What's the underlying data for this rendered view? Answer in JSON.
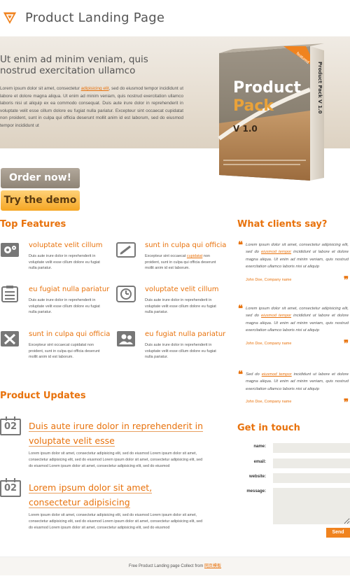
{
  "header": {
    "title": "Product Landing Page"
  },
  "hero": {
    "heading": "Ut enim ad minim veniam, quis nostrud exercitation ullamco",
    "text_before_link": "Lorem ipsum dolor sit amet, consectetur ",
    "link_text": "adipisicing elit",
    "text_after_link": ", sed do eiusmod tempor incididunt ut labore et dolore magna aliqua. Ut enim ad minim veniam, quis nostrud exercitation ullamco laboris nisi ut aliquip ex ea commodo consequat. Duis aute irure dolor in reprehenderit in voluptate velit esse cillum dolore eu fugiat nulla pariatur. Excepteur sint occaecat cupidatat non proident, sunt in culpa qui officia deserunt mollit anim id est laborum, sed do eiusmod tempor incididunt ut",
    "box": {
      "line1": "Product",
      "line2": "Pack",
      "version": "V 1.0",
      "ribbon": "featured",
      "side_text": "Product Pack V 1.0"
    },
    "order_button": "Order now!",
    "demo_button": "Try the demo"
  },
  "features": {
    "title": "Top Features",
    "items": [
      {
        "title": "voluptate velit cillum",
        "icon": "gear-icon",
        "text": "Duis aute irure dolor in reprehenderit in voluptate velit esse cillum dolore eu fugiat nulla pariatur."
      },
      {
        "title": "sunt in culpa qui officia",
        "icon": "pencil-icon",
        "text": "Excepteur sint occaecat cupidatat non proident, sunt in culpa qui officia deserunt mollit anim id est laborum."
      },
      {
        "title": "eu fugiat nulla pariatur",
        "icon": "checklist-icon",
        "text": "Duis aute irure dolor in reprehenderit in voluptate velit esse cillum dolore eu fugiat nulla pariatur."
      },
      {
        "title": "voluptate velit cillum",
        "icon": "clock-icon",
        "text": "Duis aute irure dolor in reprehenderit in voluptate velit esse cillum dolore eu fugiat nulla pariatur."
      },
      {
        "title": "sunt in culpa qui officia",
        "icon": "tools-icon",
        "text": "Excepteur sint occaecat cupidatat non proident, sunt in culpa qui officia deserunt mollit anim id est laborum."
      },
      {
        "title": "eu fugiat nulla pariatur",
        "icon": "users-icon",
        "text": "Duis aute irure dolor in reprehenderit in voluptate velit esse cillum dolore eu fugiat nulla pariatur."
      }
    ]
  },
  "clients": {
    "title": "What clients say?",
    "testimonials": [
      {
        "before": "Lorem ipsum dolor sit amet, consectetur adipisicing elit, sed do ",
        "link": "eiusmod tempor",
        "after": " incididunt ut labore et dolore magna aliqua. Ut enim ad minim veniam, quis nostrud exercitation ullamco laboris nisi ut aliquip",
        "author": "John Doe, Company name"
      },
      {
        "before": "Lorem ipsum dolor sit amet, consectetur adipisicing elit, sed do ",
        "link": "eiusmod tempor",
        "after": " incididunt ut labore et dolore magna aliqua. Ut enim ad minim veniam, quis nostrud exercitation ullamco laboris nisi ut aliquip",
        "author": "John Doe, Company name"
      },
      {
        "before": "Sed do ",
        "link": "eiusmod tempor",
        "after": " incididunt ut labore et dolore magna aliqua. Ut enim ad minim veniam, quis nostrud exercitation ullamco laboris nisi ut aliquip",
        "author": "John Doe, Company name"
      }
    ]
  },
  "updates": {
    "title": "Product Updates",
    "items": [
      {
        "date": "02",
        "title": "Duis aute irure dolor in reprehenderit in voluptate velit esse",
        "text": "Lorem ipsum dolor sit amet, consectetur adipisicing elit, sed do eiusmod Lorem ipsum dolor sit amet, consectetur adipisicing elit, sed do eiusmod Lorem ipsum dolor sit amet, consectetur adipisicing elit, sed do eiusmod Lorem ipsum dolor sit amet, consectetur adipisicing elit, sed do eiusmod"
      },
      {
        "date": "02",
        "title": "Lorem ipsum dolor sit amet, consectetur adipisicing",
        "text": "Lorem ipsum dolor sit amet, consectetur adipisicing elit, sed do eiusmod Lorem ipsum dolor sit amet, consectetur adipisicing elit, sed do eiusmod Lorem ipsum dolor sit amet, consectetur adipisicing elit, sed do eiusmod Lorem ipsum dolor sit amet, consectetur adipisicing elit, sed do eiusmod"
      }
    ]
  },
  "contact": {
    "title": "Get in touch",
    "name_label": "name:",
    "email_label": "email:",
    "website_label": "website:",
    "message_label": "message:",
    "send_button": "Send"
  },
  "footer": {
    "text": "Free Product Landing page Collect from ",
    "link": "网页模板"
  },
  "colors": {
    "accent": "#e8720c",
    "button_gray": "#8e8476",
    "button_orange": "#f5a623",
    "input_bg": "#ecebe6"
  }
}
